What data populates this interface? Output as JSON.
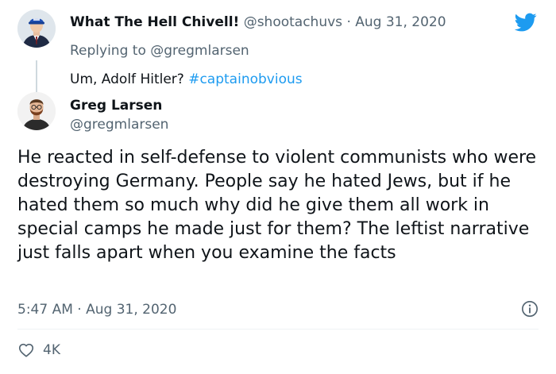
{
  "parent_tweet": {
    "display_name": "What The Hell Chivell!",
    "handle": "@shootachuvs",
    "separator": "·",
    "date": "Aug 31, 2020",
    "replying_prefix": "Replying to",
    "replying_to": "@gregmlarsen",
    "text": "Um, Adolf Hitler?",
    "hashtag": "#captainobvious",
    "avatar_icon": "avatar-man-blue-cap"
  },
  "main_tweet": {
    "display_name": "Greg Larsen",
    "handle": "@gregmlarsen",
    "text": "He reacted in self-defense to violent communists who were destroying Germany. People say he hated Jews, but if he hated them so much why did he give them all work in special camps he made just for them? The leftist narrative just falls apart when you examine the facts",
    "time": "5:47 AM",
    "separator": "·",
    "date": "Aug 31, 2020",
    "like_count": "4K",
    "avatar_icon": "avatar-bearded-man"
  },
  "icons": {
    "brand": "twitter-bird-icon",
    "info": "info-icon",
    "like": "heart-icon"
  },
  "colors": {
    "brand_blue": "#1d9bf0",
    "secondary_text": "#536471",
    "primary_text": "#0f1419"
  }
}
